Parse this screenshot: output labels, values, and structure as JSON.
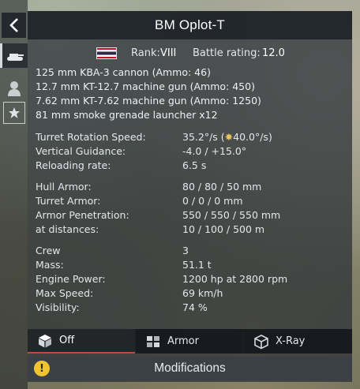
{
  "header": {
    "title": "BM Oplot-T",
    "back_icon": "chevron-left-icon"
  },
  "sidebar": {
    "items": [
      {
        "name": "tank",
        "icon": "tank-icon"
      },
      {
        "name": "crew",
        "icon": "crew-icon"
      },
      {
        "name": "favorites",
        "icon": "star-icon"
      }
    ]
  },
  "info": {
    "country_flag": "thailand-flag",
    "rank_label": "Rank:",
    "rank_value": "VIII",
    "br_label": "Battle rating:",
    "br_value": "12.0"
  },
  "weapons": [
    "125 mm KBA-3 cannon (Ammo: 46)",
    "12.7 mm KT-12.7 machine gun (Ammo: 450)",
    "7.62 mm KT-7.62 machine gun (Ammo: 1250)",
    "81 mm smoke grenade launcher x12"
  ],
  "turret": {
    "rotation_label": "Turret Rotation Speed:",
    "rotation_value": "35.2°/s (",
    "rotation_boost": "40.0°/s)",
    "vertical_label": "Vertical Guidance:",
    "vertical_value": "-4.0 / +15.0°",
    "reload_label": "Reloading rate:",
    "reload_value": "6.5 s"
  },
  "armor": {
    "hull_label": "Hull Armor:",
    "hull_value": "80 / 80 / 50 mm",
    "turret_label": "Turret Armor:",
    "turret_value": "0 / 0 / 0 mm",
    "pen_label": "Armor Penetration:",
    "pen_value": "550 / 550 / 550 mm",
    "dist_label": "at distances:",
    "dist_value": "10 / 100 / 500 m"
  },
  "mobility": {
    "crew_label": "Crew",
    "crew_value": "3",
    "mass_label": "Mass:",
    "mass_value": "51.1 t",
    "engine_label": "Engine Power:",
    "engine_value": "1200 hp at 2800 rpm",
    "speed_label": "Max Speed:",
    "speed_value": "69 km/h",
    "vis_label": "Visibility:",
    "vis_value": "74 %"
  },
  "tabs": [
    {
      "label": "Off",
      "icon": "cube-icon",
      "active": true
    },
    {
      "label": "Armor",
      "icon": "armor-cubes-icon",
      "active": false
    },
    {
      "label": "X-Ray",
      "icon": "xray-cube-icon",
      "active": false
    }
  ],
  "modifications": {
    "label": "Modifications",
    "warning_icon": "exclamation-icon",
    "warning_color": "#f0c430"
  }
}
